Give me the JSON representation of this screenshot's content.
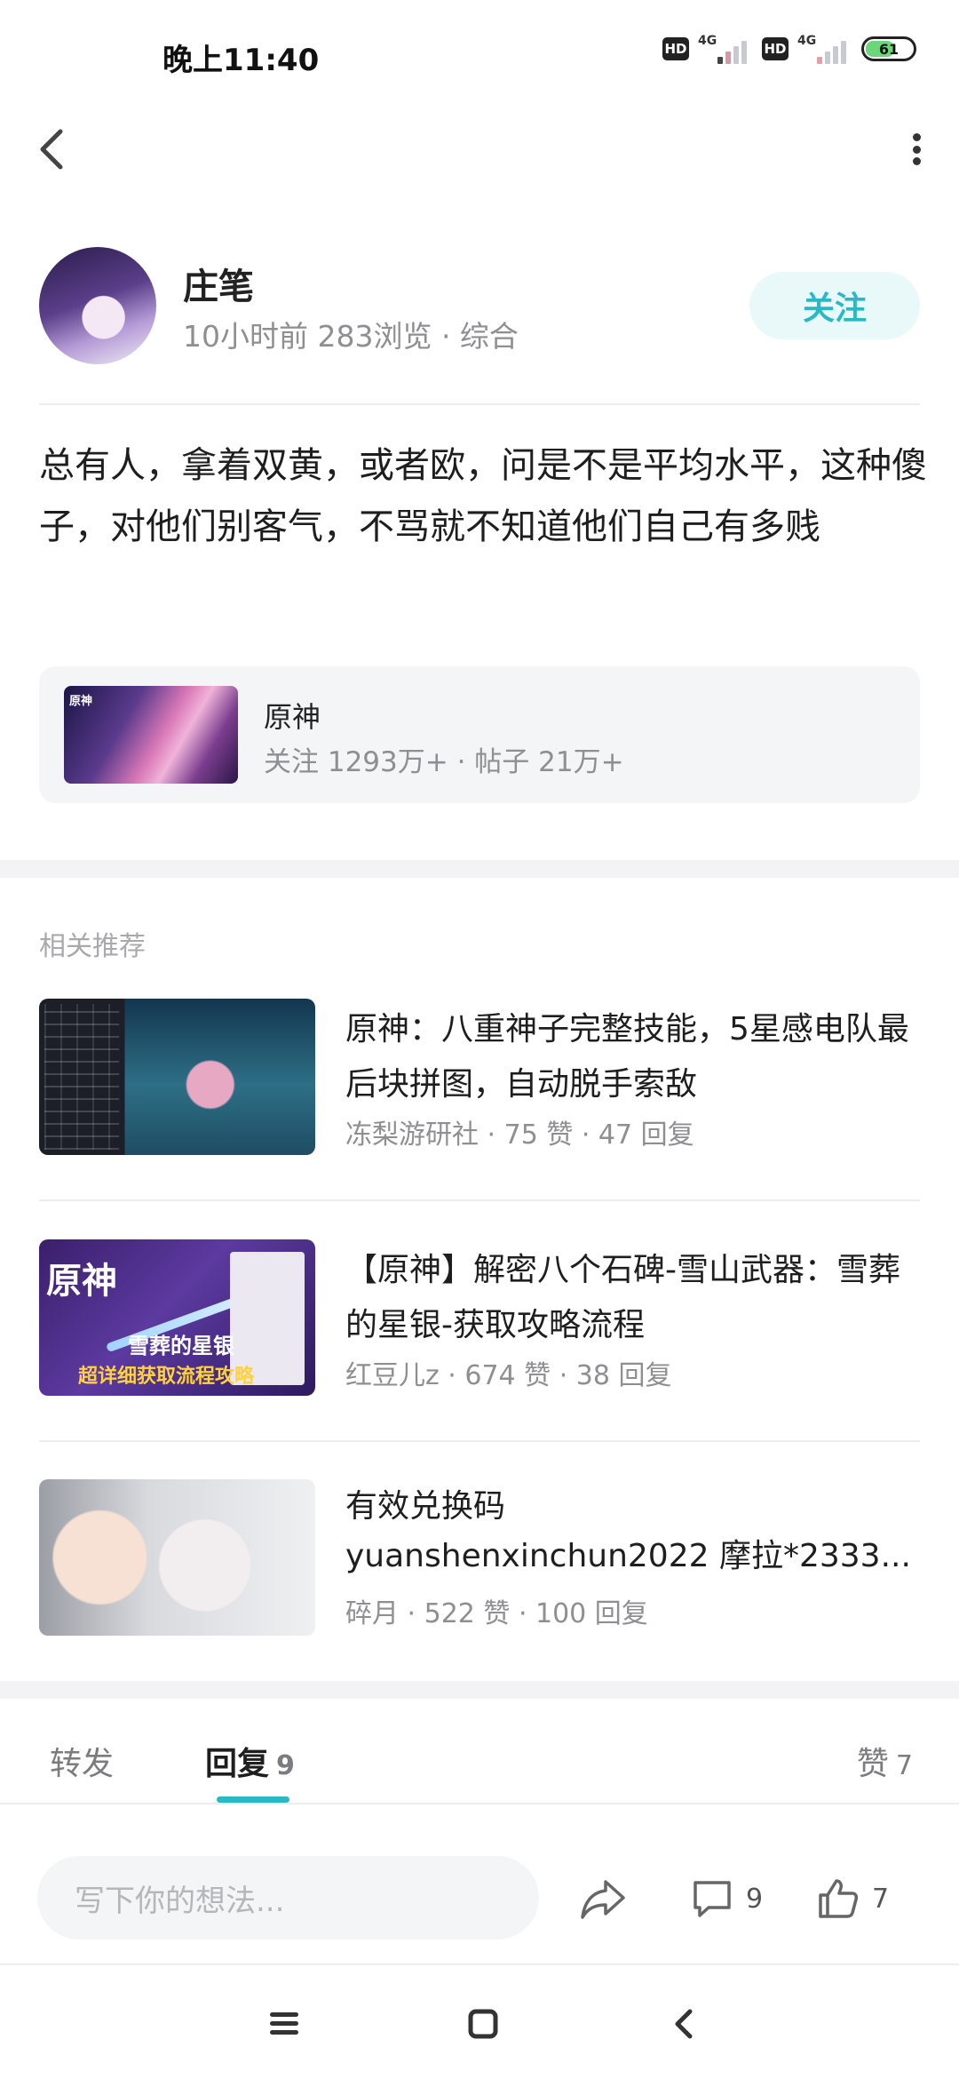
{
  "status_bar": {
    "time": "晚上11:40",
    "hd_label": "HD",
    "network_label": "4G",
    "battery": "61"
  },
  "nav": {
    "back_icon": "chevron-left-icon",
    "more_icon": "more-vertical-icon"
  },
  "author": {
    "name": "庄笔",
    "meta": "10小时前 283浏览 · 综合",
    "follow_label": "关注"
  },
  "post": {
    "content": "总有人，拿着双黄，或者欧，问是不是平均水平，这种傻子，对他们别客气，不骂就不知道他们自己有多贱"
  },
  "topic": {
    "name": "原神",
    "stats": "关注 1293万+ · 帖子 21万+",
    "thumb_tag": "原神"
  },
  "related": {
    "section_title": "相关推荐",
    "items": [
      {
        "title": "原神：八重神子完整技能，5星感电队最后块拼图，自动脱手索敌",
        "meta": "冻梨游研社 · 75 赞 · 47 回复"
      },
      {
        "title": "【原神】解密八个石碑-雪山武器：雪葬的星银-获取攻略流程",
        "meta": "红豆儿z · 674 赞 · 38 回复",
        "thumb_title": "原神",
        "thumb_subtitle": "雪葬的星银",
        "thumb_caption": "超详细获取流程攻略"
      },
      {
        "title_line1": "有效兑换码",
        "title_line2": "yuanshenxinchun2022 摩拉*2333...",
        "meta": "碎月 · 522 赞 · 100 回复"
      }
    ]
  },
  "tabs": {
    "repost": "转发",
    "reply": "回复",
    "reply_count": "9",
    "like": "赞",
    "like_count": "7"
  },
  "action_bar": {
    "input_placeholder": "写下你的想法...",
    "share_icon": "share-icon",
    "comment_count": "9",
    "like_count": "7"
  },
  "colors": {
    "accent": "#29b8c4",
    "follow_bg": "#e9f8f8"
  }
}
